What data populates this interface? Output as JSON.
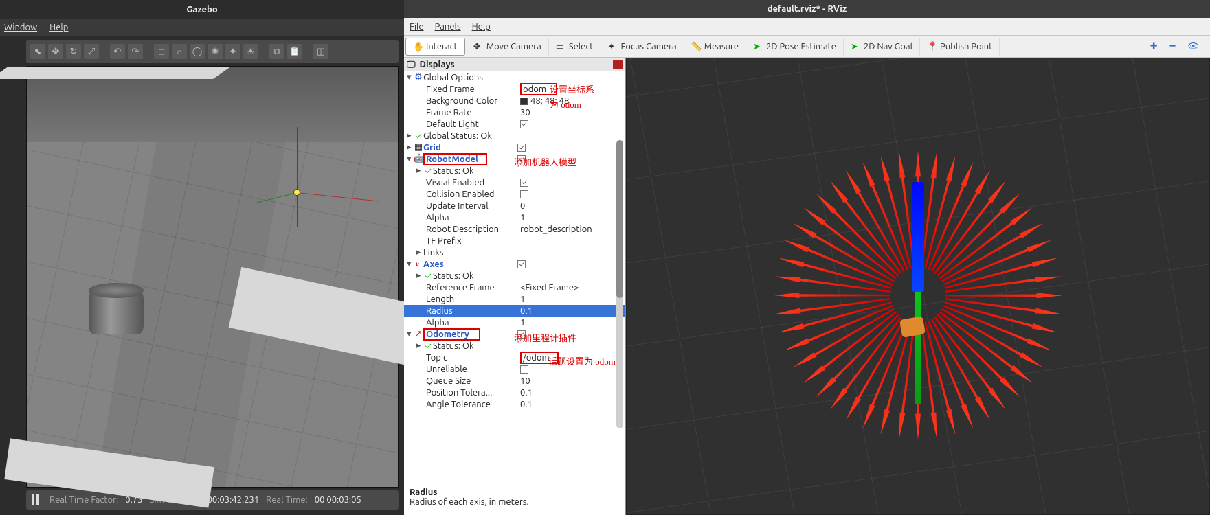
{
  "gazebo": {
    "title": "Gazebo",
    "menu": {
      "window": "Window",
      "help": "Help"
    },
    "toolbar_icons": [
      "pointer",
      "move",
      "rotate",
      "scale",
      "sep",
      "undo",
      "redo",
      "sep",
      "box",
      "sphere",
      "cylinder",
      "light-point",
      "light-spot",
      "light-dir",
      "sep",
      "copy",
      "paste",
      "sep",
      "snap"
    ],
    "status": {
      "rtf_label": "Real Time Factor:",
      "rtf_value": "0.75",
      "simtime_label": "Sim Time:",
      "simtime_value": "00 00:03:42.231",
      "realtime_label": "Real Time:",
      "realtime_value": "00 00:03:05"
    }
  },
  "rviz": {
    "title": "default.rviz* - RViz",
    "menu": {
      "file": "File",
      "panels": "Panels",
      "help": "Help"
    },
    "toolbar": {
      "interact": "Interact",
      "move": "Move Camera",
      "select": "Select",
      "focus": "Focus Camera",
      "measure": "Measure",
      "pose": "2D Pose Estimate",
      "nav": "2D Nav Goal",
      "publish": "Publish Point"
    },
    "displays_header": "Displays",
    "tree": {
      "global_options": "Global Options",
      "fixed_frame_k": "Fixed Frame",
      "fixed_frame_v": "odom",
      "bg_k": "Background Color",
      "bg_v": "48; 48; 48",
      "fr_k": "Frame Rate",
      "fr_v": "30",
      "dl_k": "Default Light",
      "dl_v": true,
      "gstatus": "Global Status: Ok",
      "grid": "Grid",
      "grid_v": true,
      "robotmodel": "RobotModel",
      "robotmodel_v": true,
      "rm_status": "Status: Ok",
      "ve_k": "Visual Enabled",
      "ve_v": true,
      "ce_k": "Collision Enabled",
      "ce_v": false,
      "ui_k": "Update Interval",
      "ui_v": "0",
      "al_k": "Alpha",
      "al_v": "1",
      "rd_k": "Robot Description",
      "rd_v": "robot_description",
      "tf_k": "TF Prefix",
      "tf_v": "",
      "links": "Links",
      "axes": "Axes",
      "axes_v": true,
      "ax_status": "Status: Ok",
      "rf_k": "Reference Frame",
      "rf_v": "<Fixed Frame>",
      "len_k": "Length",
      "len_v": "1",
      "rad_k": "Radius",
      "rad_v": "0.1",
      "al2_k": "Alpha",
      "al2_v": "1",
      "odom": "Odometry",
      "odom_v": true,
      "od_status": "Status: Ok",
      "topic_k": "Topic",
      "topic_v": "/odom",
      "unr_k": "Unreliable",
      "unr_v": false,
      "qs_k": "Queue Size",
      "qs_v": "10",
      "pt_k": "Position Tolera...",
      "pt_v": "0.1",
      "at_k": "Angle Tolerance",
      "at_v": "0.1"
    },
    "desc": {
      "title": "Radius",
      "body": "Radius of each axis, in meters."
    },
    "annotations": {
      "coord": "设置坐标系",
      "coord2": "为 odom",
      "addmodel": "添加机器人模型",
      "addodom": "添加里程计插件",
      "topic": "话题设置为 odom"
    }
  }
}
